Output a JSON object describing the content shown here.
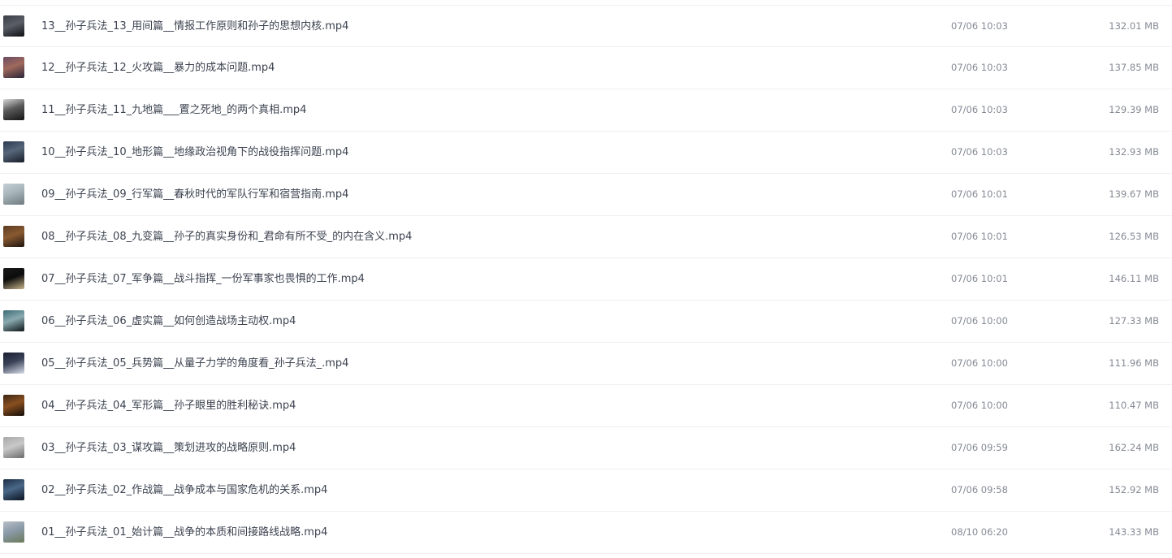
{
  "files": [
    {
      "name": "13__孙子兵法_13_用间篇__情报工作原则和孙子的思想内核.mp4",
      "time": "07/06 10:03",
      "size": "132.01 MB",
      "thumb": [
        "#3a3f48",
        "#0e1014",
        "#5b5e66"
      ]
    },
    {
      "name": "12__孙子兵法_12_火攻篇__暴力的成本问题.mp4",
      "time": "07/06 10:03",
      "size": "137.85 MB",
      "thumb": [
        "#6b4a63",
        "#2a2438",
        "#a06a5c"
      ]
    },
    {
      "name": "11__孙子兵法_11_九地篇___置之死地_的两个真相.mp4",
      "time": "07/06 10:03",
      "size": "129.39 MB",
      "thumb": [
        "#d8d8d8",
        "#141414",
        "#5a5a5a"
      ]
    },
    {
      "name": "10__孙子兵法_10_地形篇__地缘政治视角下的战役指挥问题.mp4",
      "time": "07/06 10:03",
      "size": "132.93 MB",
      "thumb": [
        "#2c3a52",
        "#161c28",
        "#58667a"
      ]
    },
    {
      "name": "09__孙子兵法_09_行军篇__春秋时代的军队行军和宿营指南.mp4",
      "time": "07/06 10:01",
      "size": "139.67 MB",
      "thumb": [
        "#c5cfd6",
        "#6d7a80",
        "#a6b4ba"
      ]
    },
    {
      "name": "08__孙子兵法_08_九变篇__孙子的真实身份和_君命有所不受_的内在含义.mp4",
      "time": "07/06 10:01",
      "size": "126.53 MB",
      "thumb": [
        "#5a3b22",
        "#1c1410",
        "#8a5a30"
      ]
    },
    {
      "name": "07__孙子兵法_07_军争篇__战斗指挥_一份军事家也畏惧的工作.mp4",
      "time": "07/06 10:01",
      "size": "146.11 MB",
      "thumb": [
        "#1a1a1a",
        "#c8b48a",
        "#0c0c0c"
      ]
    },
    {
      "name": "06__孙子兵法_06_虚实篇__如何创造战场主动权.mp4",
      "time": "07/06 10:00",
      "size": "127.33 MB",
      "thumb": [
        "#3c6a74",
        "#0c1416",
        "#8aaab0"
      ]
    },
    {
      "name": "05__孙子兵法_05_兵势篇__从量子力学的角度看_孙子兵法_.mp4",
      "time": "07/06 10:00",
      "size": "111.96 MB",
      "thumb": [
        "#1a2030",
        "#d8dde8",
        "#3a4258"
      ]
    },
    {
      "name": "04__孙子兵法_04_军形篇__孙子眼里的胜利秘诀.mp4",
      "time": "07/06 10:00",
      "size": "110.47 MB",
      "thumb": [
        "#3a2614",
        "#120c08",
        "#8a5020"
      ]
    },
    {
      "name": "03__孙子兵法_03_谋攻篇__策划进攻的战略原则.mp4",
      "time": "07/06 09:59",
      "size": "162.24 MB",
      "thumb": [
        "#a8a8a8",
        "#6a6a6a",
        "#c8c8c8"
      ]
    },
    {
      "name": "02__孙子兵法_02_作战篇__战争成本与国家危机的关系.mp4",
      "time": "07/06 09:58",
      "size": "152.92 MB",
      "thumb": [
        "#1c2c44",
        "#0a1220",
        "#4a6888"
      ]
    },
    {
      "name": "01__孙子兵法_01_始计篇__战争的本质和间接路线战略.mp4",
      "time": "08/10 06:20",
      "size": "143.33 MB",
      "thumb": [
        "#b8c0c8",
        "#6a7a5a",
        "#8a9aa8"
      ]
    }
  ]
}
